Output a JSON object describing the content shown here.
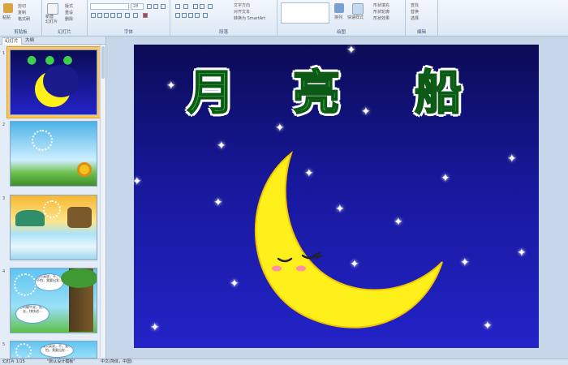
{
  "ribbon": {
    "clipboard": {
      "label": "剪贴板",
      "paste": "粘贴",
      "cut": "剪切",
      "copy": "复制",
      "format_painter": "格式刷"
    },
    "slides": {
      "label": "幻灯片",
      "new_slide": "新建\n幻灯片",
      "layout": "版式",
      "reset": "重设",
      "delete": "删除"
    },
    "font": {
      "label": "字体",
      "font_size": "28"
    },
    "paragraph": {
      "label": "段落",
      "text_direction": "文字方向",
      "align_text": "对齐文本",
      "smartart": "转换为 SmartArt"
    },
    "drawing": {
      "label": "绘图",
      "arrange": "排列",
      "quick_styles": "快速样式",
      "shape_fill": "形状填充",
      "shape_outline": "形状轮廓",
      "shape_effects": "形状效果"
    },
    "editing": {
      "label": "编辑",
      "find": "查找",
      "replace": "替换",
      "select": "选择"
    }
  },
  "panel": {
    "tab_slides": "幻灯片",
    "tab_outline": "大纲",
    "slide_numbers": [
      "1",
      "2",
      "3",
      "4",
      "5"
    ],
    "bubble1": "蒲公英说，不，我不怕，我要出发…",
    "bubble2": "好心的蜗牛说，别，别去，快快进…",
    "bubble3": "蒲公英说，不，我不怕，我要出发…"
  },
  "slide": {
    "title_chars": [
      "月",
      "亮",
      "船"
    ]
  },
  "statusbar": {
    "slide_info": "幻灯片 1/15",
    "theme": "\"默认设计模板\"",
    "language": "中文(简体，中国)"
  },
  "colors": {
    "slide_top": "#0b0b55",
    "slide_bottom": "#2323c8",
    "moon": "#ffef1a",
    "title_green": "#3fd04a"
  }
}
